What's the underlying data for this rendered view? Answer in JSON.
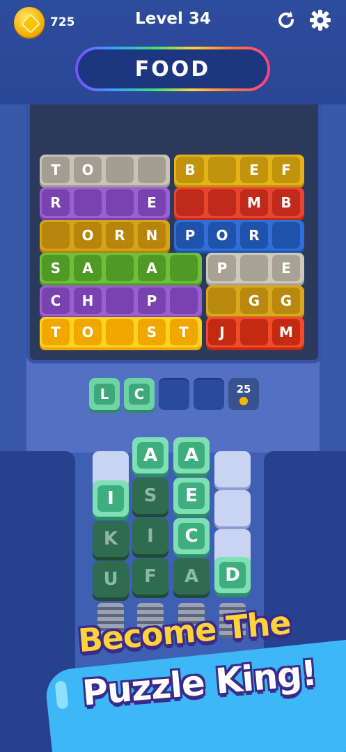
{
  "header": {
    "coins": "725",
    "level": "Level 34",
    "restart_icon": "restart-icon",
    "settings_icon": "gear-icon",
    "category": "FOOD"
  },
  "board": {
    "rows": [
      {
        "groups": [
          {
            "color": "#c9c2b6",
            "dark": "#a49d92",
            "letters": [
              "T",
              "O",
              "",
              ""
            ]
          },
          {
            "color": "#e6b21a",
            "dark": "#c2930c",
            "letters": [
              "B",
              "",
              "E",
              "F"
            ]
          }
        ]
      },
      {
        "groups": [
          {
            "color": "#9a5fd0",
            "dark": "#7a41b0",
            "letters": [
              "R",
              "",
              "",
              "E"
            ]
          },
          {
            "color": "#e8452f",
            "dark": "#c02a1a",
            "letters": [
              "",
              "",
              "M",
              "B"
            ]
          }
        ]
      },
      {
        "groups": [
          {
            "color": "#d6a318",
            "dark": "#b7850c",
            "letters": [
              "",
              "O",
              "R",
              "N"
            ]
          },
          {
            "color": "#2f6fd6",
            "dark": "#1f52aa",
            "letters": [
              "P",
              "O",
              "R",
              ""
            ]
          }
        ]
      },
      {
        "groups": [
          {
            "color": "#6fbf3c",
            "dark": "#4f9a25",
            "letters": [
              "S",
              "A",
              "",
              "A",
              ""
            ]
          },
          {
            "color": "#cfc8bc",
            "dark": "#a8a196",
            "letters": [
              "P",
              "",
              "E"
            ]
          }
        ]
      },
      {
        "groups": [
          {
            "color": "#9a5fd0",
            "dark": "#7a41b0",
            "letters": [
              "C",
              "H",
              "",
              "P",
              ""
            ]
          },
          {
            "color": "#d9a81e",
            "dark": "#b8890e",
            "letters": [
              "",
              "G",
              "G"
            ]
          }
        ]
      },
      {
        "groups": [
          {
            "color": "#ffd21f",
            "dark": "#f0a800",
            "letters": [
              "T",
              "O",
              "",
              "S",
              "T"
            ]
          },
          {
            "color": "#f24a2a",
            "dark": "#c42a12",
            "letters": [
              "J",
              "",
              "M"
            ]
          }
        ]
      }
    ]
  },
  "answer": {
    "slots": [
      "L",
      "C",
      "",
      ""
    ],
    "reward": "25"
  },
  "columns": [
    {
      "tiles": [
        {
          "t": "empty",
          "l": ""
        },
        {
          "t": "light",
          "l": "I"
        },
        {
          "t": "dark",
          "l": "K"
        },
        {
          "t": "dark",
          "l": "U"
        }
      ]
    },
    {
      "tiles": [
        {
          "t": "light",
          "l": "A"
        },
        {
          "t": "dark",
          "l": "S"
        },
        {
          "t": "dark",
          "l": "I"
        },
        {
          "t": "dark",
          "l": "F"
        }
      ]
    },
    {
      "tiles": [
        {
          "t": "light",
          "l": "A"
        },
        {
          "t": "light",
          "l": "E"
        },
        {
          "t": "light",
          "l": "C"
        },
        {
          "t": "dark",
          "l": "A"
        }
      ]
    },
    {
      "tiles": [
        {
          "t": "empty",
          "l": ""
        },
        {
          "t": "empty",
          "l": ""
        },
        {
          "t": "empty",
          "l": ""
        },
        {
          "t": "light",
          "l": "D"
        }
      ]
    }
  ],
  "promo": {
    "line1": "Become The",
    "line2": "Puzzle King!"
  }
}
